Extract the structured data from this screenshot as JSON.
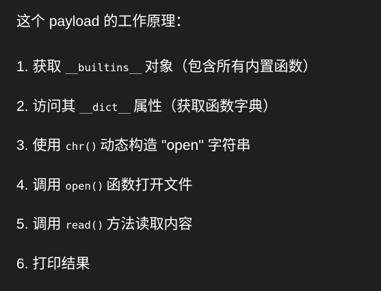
{
  "intro": "这个 payload 的工作原理：",
  "steps": [
    {
      "num": "1.",
      "pre": "获取",
      "code": "__builtins__",
      "post": "对象（包含所有内置函数）"
    },
    {
      "num": "2.",
      "pre": "访问其",
      "code": "__dict__",
      "post": "属性（获取函数字典）"
    },
    {
      "num": "3.",
      "pre": "使用",
      "code": "chr()",
      "post": "动态构造 \"open\" 字符串"
    },
    {
      "num": "4.",
      "pre": "调用",
      "code": "open()",
      "post": "函数打开文件"
    },
    {
      "num": "5.",
      "pre": "调用",
      "code": "read()",
      "post": "方法读取内容"
    },
    {
      "num": "6.",
      "pre": "打印结果",
      "code": "",
      "post": ""
    }
  ]
}
